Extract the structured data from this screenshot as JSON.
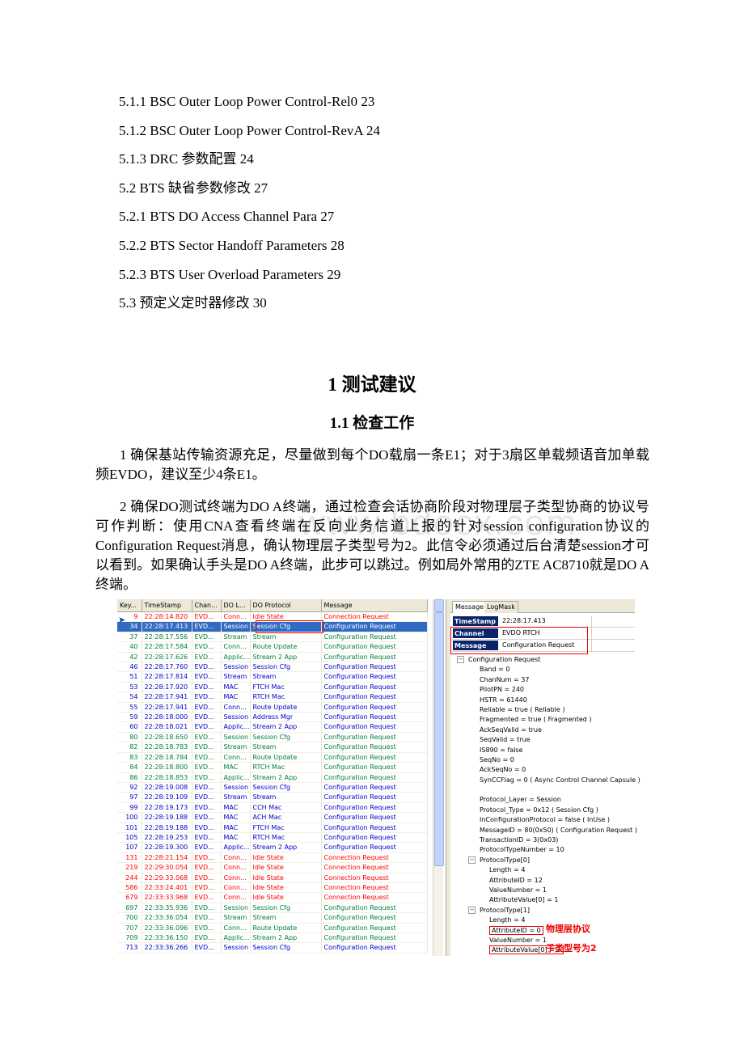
{
  "toc": [
    "5.1.1 BSC Outer Loop Power Control-Rel0 23",
    "5.1.2 BSC Outer Loop Power Control-RevA 24",
    "5.1.3 DRC 参数配置 24",
    "5.2 BTS 缺省参数修改 27",
    "5.2.1 BTS DO Access Channel Para 27",
    "5.2.2 BTS Sector Handoff Parameters 28",
    "5.2.3 BTS User Overload Parameters 29",
    "5.3 预定义定时器修改 30"
  ],
  "heading1": "1 测试建议",
  "heading2": "1.1 检查工作",
  "paragraphs": [
    "1 确保基站传输资源充足，尽量做到每个DO载扇一条E1；对于3扇区单载频语音加单载频EVDO，建议至少4条E1。",
    "2 确保DO测试终端为DO A终端，通过检查会话协商阶段对物理层子类型协商的协议号可作判断：使用CNA查看终端在反向业务信道上报的针对session configuration协议的Configuration Request消息，确认物理层子类型号为2。此信令必须通过后台清楚session才可以看到。如果确认手头是DO A终端，此步可以跳过。例如局外常用的ZTE AC8710就是DO A终端。"
  ],
  "watermark": "www.bdocx.com",
  "log_table": {
    "columns": [
      "Key...",
      "TimeStamp",
      "Chan...",
      "DO L...",
      "DO Protocol",
      "Message"
    ],
    "rows": [
      {
        "key": "9",
        "ts": "22:28:14.820",
        "chan": "EVD...",
        "layer": "Conn...",
        "proto": "Idle State",
        "msg": "Connection Request",
        "color": "red"
      },
      {
        "key": "34",
        "ts": "22:28:17.413",
        "chan": "EVD...",
        "layer": "Session",
        "proto": "Session Cfg",
        "msg": "Configuration Request",
        "color": "selected"
      },
      {
        "key": "37",
        "ts": "22:28:17.556",
        "chan": "EVD...",
        "layer": "Stream",
        "proto": "Stream",
        "msg": "Configuration Request",
        "color": "green"
      },
      {
        "key": "40",
        "ts": "22:28:17.584",
        "chan": "EVD...",
        "layer": "Conn...",
        "proto": "Route Update",
        "msg": "Configuration Request",
        "color": "green"
      },
      {
        "key": "42",
        "ts": "22:28:17.626",
        "chan": "EVD...",
        "layer": "Applic...",
        "proto": "Stream 2 App",
        "msg": "Configuration Request",
        "color": "green"
      },
      {
        "key": "46",
        "ts": "22:28:17.760",
        "chan": "EVD...",
        "layer": "Session",
        "proto": "Session Cfg",
        "msg": "Configuration Request",
        "color": "blue"
      },
      {
        "key": "51",
        "ts": "22:28:17.814",
        "chan": "EVD...",
        "layer": "Stream",
        "proto": "Stream",
        "msg": "Configuration Request",
        "color": "blue"
      },
      {
        "key": "53",
        "ts": "22:28:17.920",
        "chan": "EVD...",
        "layer": "MAC",
        "proto": "FTCH Mac",
        "msg": "Configuration Request",
        "color": "blue"
      },
      {
        "key": "54",
        "ts": "22:28:17.941",
        "chan": "EVD...",
        "layer": "MAC",
        "proto": "RTCH Mac",
        "msg": "Configuration Request",
        "color": "blue"
      },
      {
        "key": "55",
        "ts": "22:28:17.941",
        "chan": "EVD...",
        "layer": "Conn...",
        "proto": "Route Update",
        "msg": "Configuration Request",
        "color": "blue"
      },
      {
        "key": "59",
        "ts": "22:28:18.000",
        "chan": "EVD...",
        "layer": "Session",
        "proto": "Address Mgr",
        "msg": "Configuration Request",
        "color": "blue"
      },
      {
        "key": "60",
        "ts": "22:28:18.021",
        "chan": "EVD...",
        "layer": "Applic...",
        "proto": "Stream 2 App",
        "msg": "Configuration Request",
        "color": "blue"
      },
      {
        "key": "80",
        "ts": "22:28:18.650",
        "chan": "EVD...",
        "layer": "Session",
        "proto": "Session Cfg",
        "msg": "Configuration Request",
        "color": "green"
      },
      {
        "key": "82",
        "ts": "22:28:18.783",
        "chan": "EVD...",
        "layer": "Stream",
        "proto": "Stream",
        "msg": "Configuration Request",
        "color": "green"
      },
      {
        "key": "83",
        "ts": "22:28:18.784",
        "chan": "EVD...",
        "layer": "Conn...",
        "proto": "Route Update",
        "msg": "Configuration Request",
        "color": "green"
      },
      {
        "key": "84",
        "ts": "22:28:18.800",
        "chan": "EVD...",
        "layer": "MAC",
        "proto": "RTCH Mac",
        "msg": "Configuration Request",
        "color": "green"
      },
      {
        "key": "86",
        "ts": "22:28:18.853",
        "chan": "EVD...",
        "layer": "Applic...",
        "proto": "Stream 2 App",
        "msg": "Configuration Request",
        "color": "green"
      },
      {
        "key": "92",
        "ts": "22:28:19.008",
        "chan": "EVD...",
        "layer": "Session",
        "proto": "Session Cfg",
        "msg": "Configuration Request",
        "color": "blue"
      },
      {
        "key": "97",
        "ts": "22:28:19.109",
        "chan": "EVD...",
        "layer": "Stream",
        "proto": "Stream",
        "msg": "Configuration Request",
        "color": "blue"
      },
      {
        "key": "99",
        "ts": "22:28:19.173",
        "chan": "EVD...",
        "layer": "MAC",
        "proto": "CCH Mac",
        "msg": "Configuration Request",
        "color": "blue"
      },
      {
        "key": "100",
        "ts": "22:28:19.188",
        "chan": "EVD...",
        "layer": "MAC",
        "proto": "ACH Mac",
        "msg": "Configuration Request",
        "color": "blue"
      },
      {
        "key": "101",
        "ts": "22:28:19.188",
        "chan": "EVD...",
        "layer": "MAC",
        "proto": "FTCH Mac",
        "msg": "Configuration Request",
        "color": "blue"
      },
      {
        "key": "105",
        "ts": "22:28:19.253",
        "chan": "EVD...",
        "layer": "MAC",
        "proto": "RTCH Mac",
        "msg": "Configuration Request",
        "color": "blue"
      },
      {
        "key": "107",
        "ts": "22:28:19.300",
        "chan": "EVD...",
        "layer": "Applic...",
        "proto": "Stream 2 App",
        "msg": "Configuration Request",
        "color": "blue"
      },
      {
        "key": "131",
        "ts": "22:28:21.154",
        "chan": "EVD...",
        "layer": "Conn...",
        "proto": "Idle State",
        "msg": "Connection Request",
        "color": "red"
      },
      {
        "key": "219",
        "ts": "22:29:30.054",
        "chan": "EVD...",
        "layer": "Conn...",
        "proto": "Idle State",
        "msg": "Connection Request",
        "color": "red"
      },
      {
        "key": "244",
        "ts": "22:29:33.068",
        "chan": "EVD...",
        "layer": "Conn...",
        "proto": "Idle State",
        "msg": "Connection Request",
        "color": "red"
      },
      {
        "key": "586",
        "ts": "22:33:24.401",
        "chan": "EVD...",
        "layer": "Conn...",
        "proto": "Idle State",
        "msg": "Connection Request",
        "color": "red"
      },
      {
        "key": "679",
        "ts": "22:33:33.968",
        "chan": "EVD...",
        "layer": "Conn...",
        "proto": "Idle State",
        "msg": "Connection Request",
        "color": "red"
      },
      {
        "key": "697",
        "ts": "22:33:35.936",
        "chan": "EVD...",
        "layer": "Session",
        "proto": "Session Cfg",
        "msg": "Configuration Request",
        "color": "green"
      },
      {
        "key": "700",
        "ts": "22:33:36.054",
        "chan": "EVD...",
        "layer": "Stream",
        "proto": "Stream",
        "msg": "Configuration Request",
        "color": "green"
      },
      {
        "key": "707",
        "ts": "22:33:36.096",
        "chan": "EVD...",
        "layer": "Conn...",
        "proto": "Route Update",
        "msg": "Configuration Request",
        "color": "green"
      },
      {
        "key": "709",
        "ts": "22:33:36.150",
        "chan": "EVD...",
        "layer": "Applic...",
        "proto": "Stream 2 App",
        "msg": "Configuration Request",
        "color": "green"
      },
      {
        "key": "713",
        "ts": "22:33:36.266",
        "chan": "EVD...",
        "layer": "Session",
        "proto": "Session Cfg",
        "msg": "Configuration Request",
        "color": "blue"
      }
    ]
  },
  "detail_panel": {
    "tabs": [
      "Message",
      "LogMask"
    ],
    "fields": [
      {
        "k": "TimeStamp",
        "v": "22:28:17.413"
      },
      {
        "k": "Channel",
        "v": "EVDO RTCH"
      },
      {
        "k": "Message",
        "v": "Configuration Request"
      }
    ],
    "tree": [
      {
        "t": "Configuration Request",
        "lvl": "ind0",
        "exp": true
      },
      {
        "t": "Band = 0",
        "lvl": "ind1"
      },
      {
        "t": "ChanNum = 37",
        "lvl": "ind1"
      },
      {
        "t": "PilotPN = 240",
        "lvl": "ind1"
      },
      {
        "t": "HSTR = 61440",
        "lvl": "ind1"
      },
      {
        "t": "Reliable = true ( Reliable )",
        "lvl": "ind1"
      },
      {
        "t": "Fragmented = true ( Fragmented )",
        "lvl": "ind1"
      },
      {
        "t": "AckSeqValid = true",
        "lvl": "ind1"
      },
      {
        "t": "SeqValid = true",
        "lvl": "ind1"
      },
      {
        "t": "IS890 = false",
        "lvl": "ind1"
      },
      {
        "t": "SeqNo = 0",
        "lvl": "ind1"
      },
      {
        "t": "AckSeqNo = 0",
        "lvl": "ind1"
      },
      {
        "t": "SynCCFlag = 0 ( Async Control Channel Capsule )",
        "lvl": "ind1"
      },
      {
        "t": "",
        "lvl": "ind1"
      },
      {
        "t": "Protocol_Layer = Session",
        "lvl": "ind1"
      },
      {
        "t": "Protocol_Type = 0x12 ( Session Cfg )",
        "lvl": "ind1"
      },
      {
        "t": "InConfigurationProtocol = false ( InUse )",
        "lvl": "ind1"
      },
      {
        "t": "MessageID = 80(0x50) ( Configuration Request )",
        "lvl": "ind1"
      },
      {
        "t": "TransactionID = 3(0x03)",
        "lvl": "ind1"
      },
      {
        "t": "ProtocolTypeNumber = 10",
        "lvl": "ind1"
      },
      {
        "t": "ProtocolType[0]",
        "lvl": "ind1e",
        "exp": true
      },
      {
        "t": "Length = 4",
        "lvl": "ind2"
      },
      {
        "t": "AttributeID = 12",
        "lvl": "ind2"
      },
      {
        "t": "ValueNumber = 1",
        "lvl": "ind2"
      },
      {
        "t": "AttributeValue[0] = 1",
        "lvl": "ind2"
      },
      {
        "t": "ProtocolType[1]",
        "lvl": "ind1e",
        "exp": true
      },
      {
        "t": "Length = 4",
        "lvl": "ind2"
      },
      {
        "t": "AttributeID = 0",
        "lvl": "ind2",
        "boxed": true,
        "ann": "物理层协议"
      },
      {
        "t": "ValueNumber = 1",
        "lvl": "ind2"
      },
      {
        "t": "AttributeValue[0] = 2",
        "lvl": "ind2",
        "boxed": true,
        "ann": "子类型号为2"
      }
    ]
  }
}
